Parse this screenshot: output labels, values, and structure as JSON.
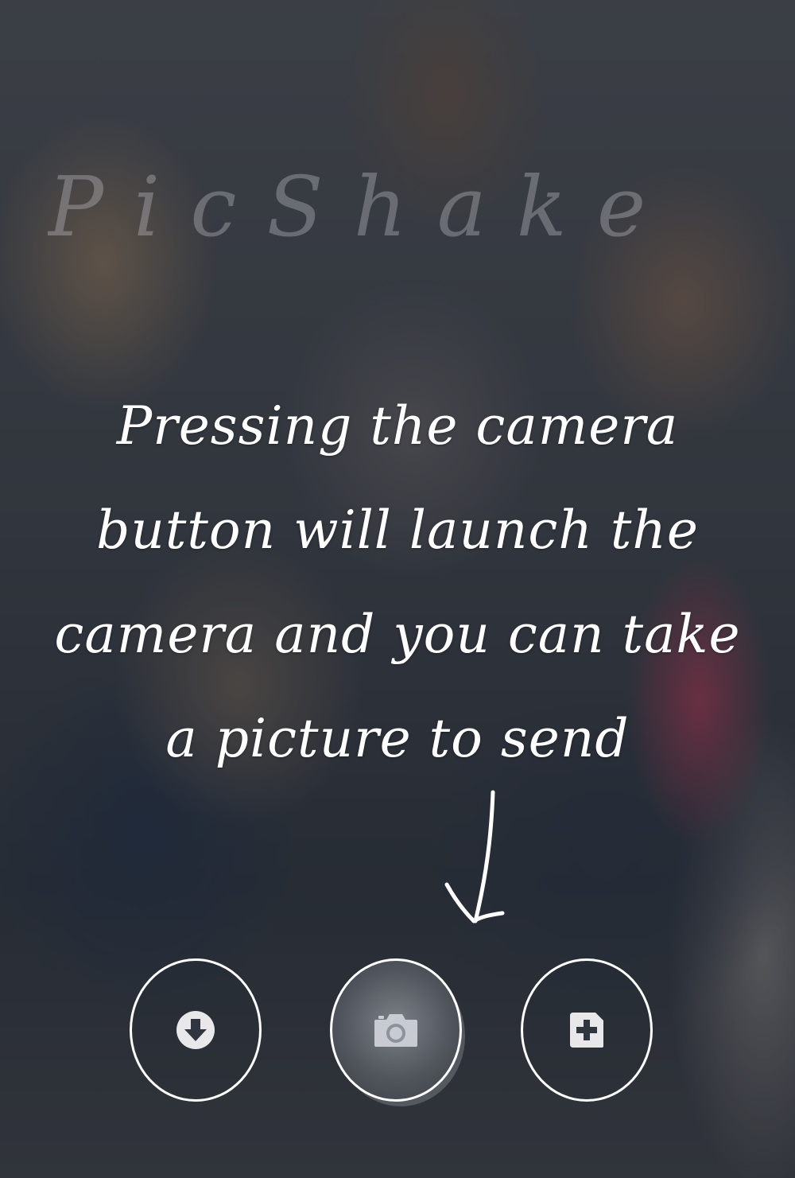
{
  "app": {
    "name": "PicShake"
  },
  "tutorial": {
    "message": "Pressing the camera button will launch the camera and you can take a picture to send"
  },
  "toolbar": {
    "buttons": [
      {
        "id": "download",
        "icon": "download-icon"
      },
      {
        "id": "camera",
        "icon": "camera-icon"
      },
      {
        "id": "add",
        "icon": "add-icon"
      }
    ]
  },
  "colors": {
    "text": "#ffffff",
    "icon": "#e8e8ea",
    "camera_icon": "#c8ccd2"
  }
}
